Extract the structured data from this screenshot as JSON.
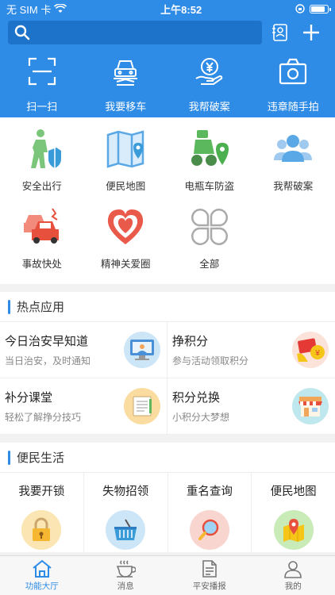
{
  "status_bar": {
    "carrier": "无 SIM 卡",
    "time": "上午8:52",
    "battery_level": 0.85
  },
  "search": {
    "placeholder": ""
  },
  "quick_actions": [
    {
      "label": "扫一扫",
      "icon": "scan-icon"
    },
    {
      "label": "我要移车",
      "icon": "car-move-icon"
    },
    {
      "label": "我帮破案",
      "icon": "reward-hand-icon"
    },
    {
      "label": "违章随手拍",
      "icon": "camera-icon"
    }
  ],
  "functions": [
    {
      "label": "安全出行",
      "icon": "safe-travel-icon"
    },
    {
      "label": "便民地图",
      "icon": "map-icon"
    },
    {
      "label": "电瓶车防盗",
      "icon": "ebike-icon"
    },
    {
      "label": "我帮破案",
      "icon": "people-icon"
    },
    {
      "label": "事故快处",
      "icon": "accident-icon"
    },
    {
      "label": "精神关爱圈",
      "icon": "heart-icon"
    },
    {
      "label": "全部",
      "icon": "all-icon"
    }
  ],
  "hot_section": {
    "title": "热点应用"
  },
  "hot_apps": [
    {
      "title": "今日治安早知道",
      "subtitle": "当日治安，及时通知",
      "icon": "monitor-icon"
    },
    {
      "title": "挣积分",
      "subtitle": "参与活动领取积分",
      "icon": "redpacket-icon"
    },
    {
      "title": "补分课堂",
      "subtitle": "轻松了解挣分技巧",
      "icon": "notebook-icon"
    },
    {
      "title": "积分兑换",
      "subtitle": "小积分大梦想",
      "icon": "shop-icon"
    }
  ],
  "life_section": {
    "title": "便民生活"
  },
  "life_services": [
    {
      "label": "我要开锁",
      "icon": "lock-icon"
    },
    {
      "label": "失物招领",
      "icon": "basket-icon"
    },
    {
      "label": "重名查询",
      "icon": "magnifier-icon"
    },
    {
      "label": "便民地图",
      "icon": "map-pin-icon"
    }
  ],
  "tabs": [
    {
      "label": "功能大厅",
      "icon": "home-icon",
      "active": true
    },
    {
      "label": "消息",
      "icon": "coffee-icon",
      "active": false
    },
    {
      "label": "平安播报",
      "icon": "document-icon",
      "active": false
    },
    {
      "label": "我的",
      "icon": "user-icon",
      "active": false
    }
  ],
  "colors": {
    "primary": "#2e8be6",
    "search_bg": "#1c73c9"
  }
}
